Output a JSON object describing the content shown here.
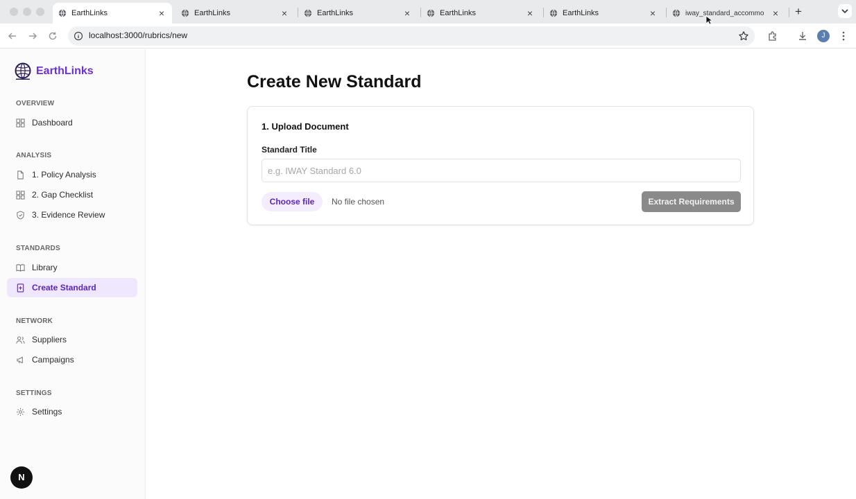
{
  "browser": {
    "tabs": [
      {
        "title": "EarthLinks",
        "active": true
      },
      {
        "title": "EarthLinks",
        "active": false
      },
      {
        "title": "EarthLinks",
        "active": false
      },
      {
        "title": "EarthLinks",
        "active": false
      },
      {
        "title": "EarthLinks",
        "active": false
      },
      {
        "title": "iway_standard_accommo",
        "active": false
      }
    ],
    "url": "localhost:3000/rubrics/new",
    "profile_initial": "J"
  },
  "sidebar": {
    "brand": "EarthLinks",
    "sections": [
      {
        "label": "OVERVIEW",
        "items": [
          {
            "label": "Dashboard",
            "icon": "grid-icon"
          }
        ]
      },
      {
        "label": "ANALYSIS",
        "items": [
          {
            "label": "1. Policy Analysis",
            "icon": "document-icon"
          },
          {
            "label": "2. Gap Checklist",
            "icon": "grid-icon"
          },
          {
            "label": "3. Evidence Review",
            "icon": "shield-icon"
          }
        ]
      },
      {
        "label": "STANDARDS",
        "items": [
          {
            "label": "Library",
            "icon": "book-icon"
          },
          {
            "label": "Create Standard",
            "icon": "file-plus-icon",
            "active": true
          }
        ]
      },
      {
        "label": "NETWORK",
        "items": [
          {
            "label": "Suppliers",
            "icon": "users-icon"
          },
          {
            "label": "Campaigns",
            "icon": "megaphone-icon"
          }
        ]
      },
      {
        "label": "SETTINGS",
        "items": [
          {
            "label": "Settings",
            "icon": "gear-icon"
          }
        ]
      }
    ]
  },
  "main": {
    "title": "Create New Standard",
    "card": {
      "title": "1. Upload Document",
      "field_label": "Standard Title",
      "title_value": "",
      "title_placeholder": "e.g. IWAY Standard 6.0",
      "choose_file_label": "Choose file",
      "file_status": "No file chosen",
      "extract_label": "Extract Requirements"
    }
  },
  "dev_badge": "N",
  "colors": {
    "accent": "#6b2fd9",
    "active_bg": "#efe7fe",
    "disabled_button": "#8a8a8a"
  }
}
